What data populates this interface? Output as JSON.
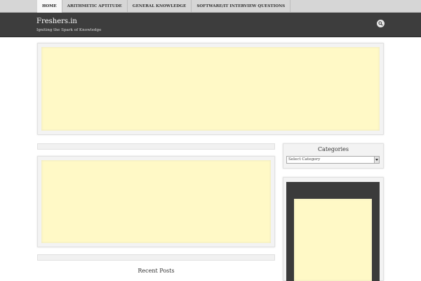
{
  "nav": {
    "items": [
      {
        "label": "Home"
      },
      {
        "label": "Arithmetic Aptitude"
      },
      {
        "label": "General Knowledge"
      },
      {
        "label": "Software/IT Interview Questions"
      }
    ]
  },
  "header": {
    "brand": "Freshers.in",
    "tagline": "Igniting the Spark of Knowledge",
    "search_icon": "search-icon"
  },
  "sidebar": {
    "categories_title": "Categories",
    "category_select_value": "Select Category"
  },
  "main": {
    "recent_posts_title": "Recent Posts"
  },
  "colors": {
    "header_bg": "#3d3d3d",
    "nav_bg": "#d6d6d6",
    "ad_bg": "#fff9c6"
  }
}
